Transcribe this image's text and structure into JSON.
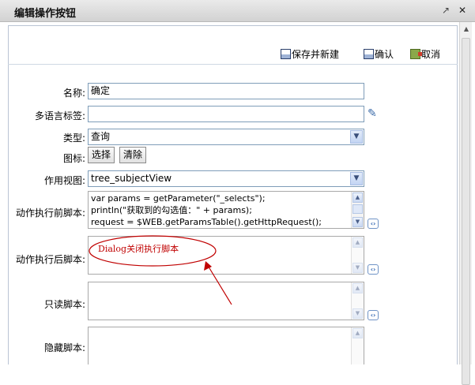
{
  "window": {
    "title": "编辑操作按钮",
    "restore_icon": "↗",
    "close_icon": "✕"
  },
  "toolbar": {
    "save_new_label": "保存并新建",
    "confirm_label": "确认",
    "cancel_label": "取消"
  },
  "form": {
    "name": {
      "label": "名称:",
      "value": "确定"
    },
    "multilang": {
      "label": "多语言标签:",
      "value": ""
    },
    "type": {
      "label": "类型:",
      "value": "查询"
    },
    "icon": {
      "label": "图标:",
      "select_label": "选择",
      "clear_label": "清除"
    },
    "view": {
      "label": "作用视图:",
      "value": "tree_subjectView"
    },
    "pre_script": {
      "label": "动作执行前脚本:",
      "lines": [
        "var params = getParameter(\"_selects\");",
        "println(\"获取到的勾选值：\" + params);",
        "request = $WEB.getParamsTable().getHttpRequest();"
      ]
    },
    "post_script": {
      "label": "动作执行后脚本:"
    },
    "readonly_script": {
      "label": "只读脚本:"
    },
    "hidden_script": {
      "label": "隐藏脚本:"
    }
  },
  "annotation": {
    "text": "Dialog关闭执行脚本",
    "color": "#c00000"
  }
}
